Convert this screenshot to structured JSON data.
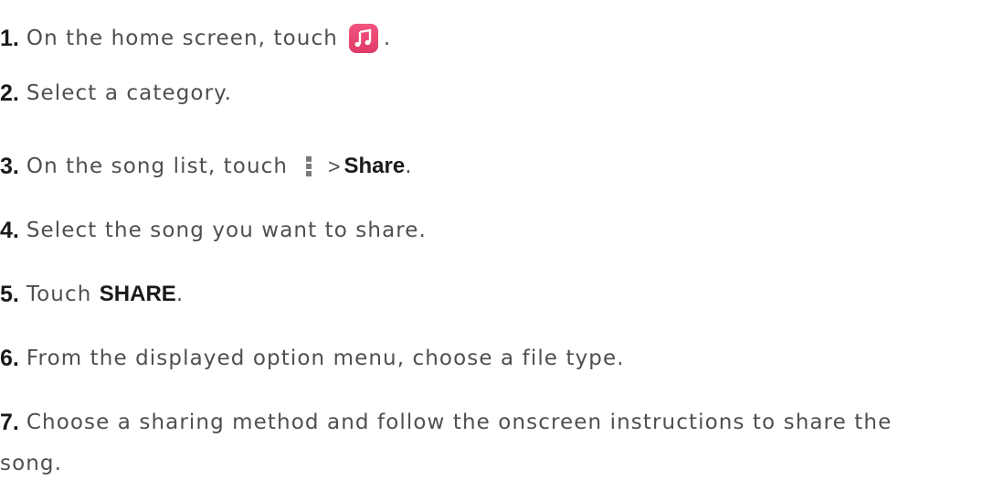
{
  "steps": [
    {
      "num": "1.",
      "text": "On the home screen, touch",
      "after": ".",
      "icon": "music-app-icon"
    },
    {
      "num": "2.",
      "text": "Select a category."
    },
    {
      "num": "3.",
      "text": "On the song list, touch",
      "sep": ">",
      "bold": "Share",
      "after": ".",
      "icon": "more-menu-icon"
    },
    {
      "num": "4.",
      "text": "Select the song you want to share."
    },
    {
      "num": "5.",
      "text": "Touch",
      "bold": "SHARE",
      "after": "."
    },
    {
      "num": "6.",
      "text": "From the displayed option menu, choose a file type."
    },
    {
      "num": "7.",
      "text": "Choose a sharing method and follow the onscreen instructions to share the",
      "continuation": "song."
    }
  ],
  "colors": {
    "text": "#4f4f4f",
    "number": "#1a1a1a",
    "icon_gradient_top": "#f2557f",
    "icon_gradient_bottom": "#e03b68",
    "menu_dots": "#7a7a7a"
  }
}
